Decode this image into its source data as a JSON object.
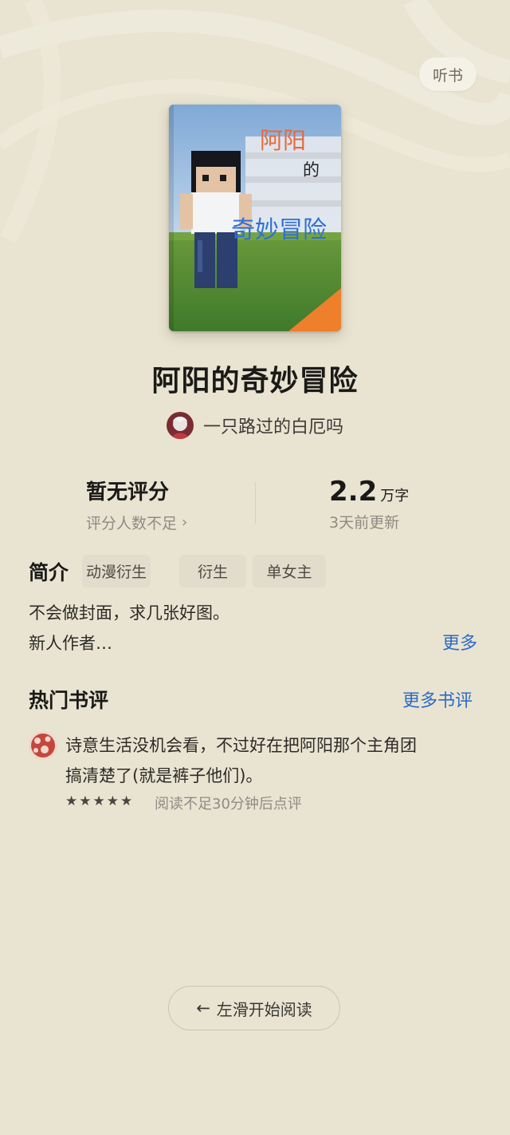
{
  "header": {
    "listen_label": "听书"
  },
  "cover": {
    "title_line1": "阿阳",
    "title_line2": "的",
    "title_line3": "奇妙冒险"
  },
  "book": {
    "title": "阿阳的奇妙冒险",
    "author": "一只路过的白厄吗"
  },
  "stats": {
    "rating_label": "暂无评分",
    "rating_sub": "评分人数不足",
    "word_count": "2.2",
    "word_unit": "万字",
    "updated": "3天前更新"
  },
  "intro": {
    "label": "简介",
    "tags": [
      "动漫衍生",
      "衍生",
      "单女主"
    ],
    "line1": "不会做封面，求几张好图。",
    "line2": "新人作者…",
    "more_label": "更多"
  },
  "reviews": {
    "title": "热门书评",
    "more_label": "更多书评",
    "items": [
      {
        "line1": "诗意生活没机会看，不过好在把阿阳那个主角团",
        "line2": "搞清楚了(就是裤子他们)。",
        "stars": 5,
        "meta": "阅读不足30分钟后点评"
      }
    ]
  },
  "footer": {
    "swipe_label": "左滑开始阅读"
  },
  "colors": {
    "accent_blue": "#2e6bc7",
    "background": "#e9e4d2"
  }
}
